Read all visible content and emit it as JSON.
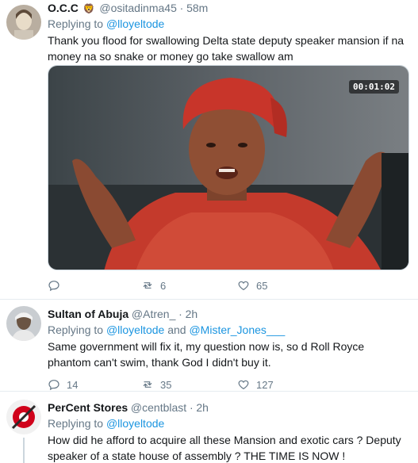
{
  "tweets": [
    {
      "name": "O.C.C",
      "badge": "🦁",
      "handle": "@ositadinma45",
      "time": "58m",
      "replying_label": "Replying to",
      "replying_to": "@lloyeltode",
      "replying_extra": "",
      "text": "Thank you flood for swallowing Delta state deputy speaker mansion if na money na so snake or money go take swallow am",
      "video_time": "00:01:02",
      "stats": {
        "replies": "",
        "retweets": "6",
        "likes": "65"
      }
    },
    {
      "name": "Sultan of Abuja",
      "handle": "@Atren_",
      "time": "2h",
      "replying_label": "Replying to",
      "replying_to": "@lloyeltode",
      "replying_and": "and",
      "replying_extra": "@Mister_Jones___",
      "text": "Same government will fix it, my question now is, so d Roll Royce phantom can't swim, thank God I didn't buy it.",
      "stats": {
        "replies": "14",
        "retweets": "35",
        "likes": "127"
      }
    },
    {
      "name": "PerCent Stores",
      "handle": "@centblast",
      "time": "2h",
      "replying_label": "Replying to",
      "replying_to": "@lloyeltode",
      "text": "How did he afford to acquire all these Mansion and exotic cars ? Deputy speaker of a state house of assembly ?  THE TIME IS NOW !"
    }
  ],
  "dot": "·",
  "colors": {
    "link": "#1b95e0",
    "muted": "#657786",
    "border": "#e6ecf0"
  }
}
